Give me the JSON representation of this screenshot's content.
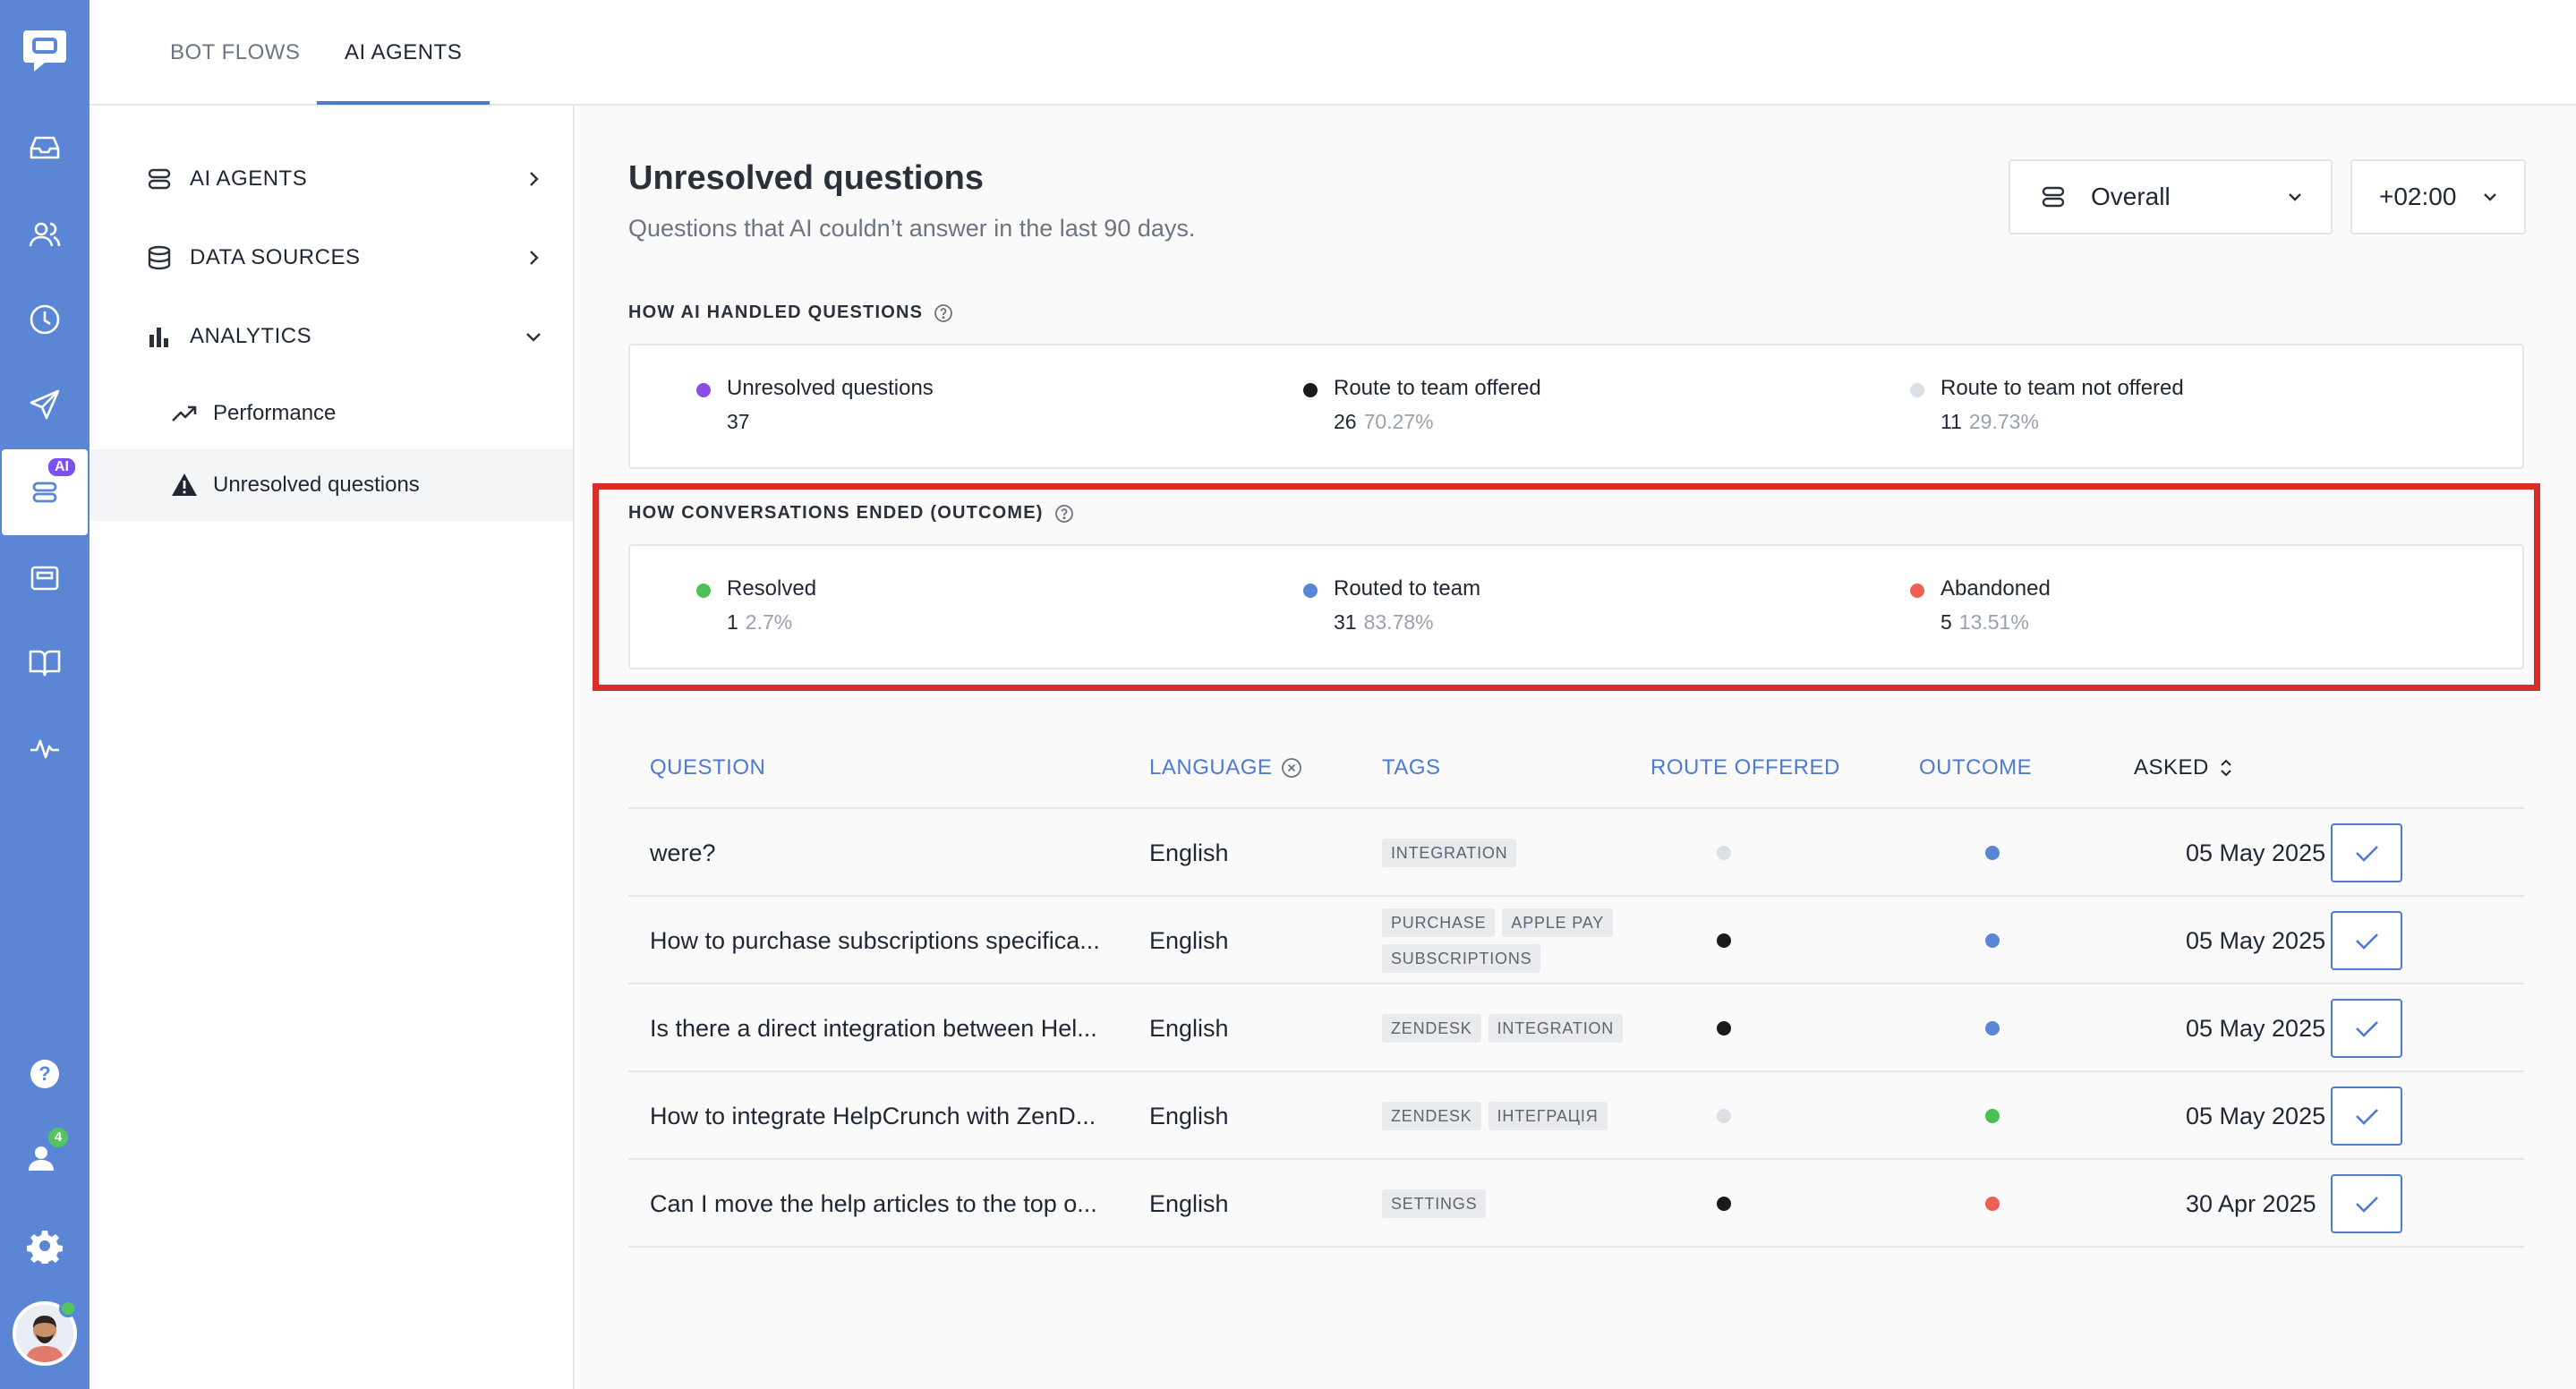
{
  "app": {
    "logo_icon": "chat-bubble-logo-icon"
  },
  "rail": {
    "items": [
      {
        "icon": "inbox-icon"
      },
      {
        "icon": "contacts-icon"
      },
      {
        "icon": "clock-icon"
      },
      {
        "icon": "send-icon"
      },
      {
        "icon": "ai-agent-icon",
        "badge": "AI",
        "active": true
      },
      {
        "icon": "widget-icon"
      },
      {
        "icon": "knowledge-base-icon"
      },
      {
        "icon": "activity-icon"
      }
    ],
    "bottom": [
      {
        "icon": "help-icon"
      },
      {
        "icon": "team-icon",
        "badge": "4"
      },
      {
        "icon": "settings-icon"
      },
      {
        "icon": "avatar"
      }
    ]
  },
  "topbar": {
    "tabs": [
      {
        "label": "BOT FLOWS"
      },
      {
        "label": "AI AGENTS",
        "active": true
      }
    ]
  },
  "subnav": {
    "items": [
      {
        "label": "AI AGENTS",
        "icon": "ai-agent-icon"
      },
      {
        "label": "DATA SOURCES",
        "icon": "database-icon"
      },
      {
        "label": "ANALYTICS",
        "icon": "bar-chart-icon",
        "expanded": true
      }
    ],
    "sub_items": [
      {
        "label": "Performance",
        "icon": "trend-up-icon"
      },
      {
        "label": "Unresolved questions",
        "icon": "warning-icon",
        "active": true
      }
    ]
  },
  "main": {
    "title": "Unresolved questions",
    "subtitle": "Questions that AI couldn’t answer in the last 90 days.",
    "filter": {
      "agent_value": "Overall",
      "timezone_value": "+02:00"
    },
    "handled": {
      "label": "HOW AI HANDLED QUESTIONS",
      "stats": [
        {
          "name": "Unresolved questions",
          "value": "37",
          "pct": "",
          "color": "#8b4fe6"
        },
        {
          "name": "Route to team offered",
          "value": "26",
          "pct": "70.27%",
          "color": "#1a1a1a"
        },
        {
          "name": "Route to team not offered",
          "value": "11",
          "pct": "29.73%",
          "color": "#dcdfe3"
        }
      ]
    },
    "outcome": {
      "label": "HOW CONVERSATIONS ENDED (OUTCOME)",
      "stats": [
        {
          "name": "Resolved",
          "value": "1",
          "pct": "2.7%",
          "color": "#4cbf55"
        },
        {
          "name": "Routed to team",
          "value": "31",
          "pct": "83.78%",
          "color": "#5b86d6"
        },
        {
          "name": "Abandoned",
          "value": "5",
          "pct": "13.51%",
          "color": "#ee5f55"
        }
      ]
    },
    "table": {
      "headers": {
        "question": "QUESTION",
        "language": "LANGUAGE",
        "tags": "TAGS",
        "route_offered": "ROUTE OFFERED",
        "outcome": "OUTCOME",
        "asked": "ASKED"
      },
      "rows": [
        {
          "question": "were?",
          "language": "English",
          "tags": [
            "INTEGRATION"
          ],
          "route_color": "#dcdfe3",
          "outcome_color": "#5b86d6",
          "asked": "05 May 2025"
        },
        {
          "question": "How to purchase subscriptions specifica...",
          "language": "English",
          "tags": [
            "PURCHASE",
            "APPLE PAY",
            "SUBSCRIPTIONS"
          ],
          "route_color": "#1a1a1a",
          "outcome_color": "#5b86d6",
          "asked": "05 May 2025"
        },
        {
          "question": "Is there a direct integration between Hel...",
          "language": "English",
          "tags": [
            "ZENDESK",
            "INTEGRATION"
          ],
          "route_color": "#1a1a1a",
          "outcome_color": "#5b86d6",
          "asked": "05 May 2025"
        },
        {
          "question": "How to integrate HelpCrunch with ZenD...",
          "language": "English",
          "tags": [
            "ZENDESK",
            "ІНТЕГРАЦІЯ"
          ],
          "route_color": "#dcdfe3",
          "outcome_color": "#4cbf55",
          "asked": "05 May 2025"
        },
        {
          "question": "Can I move the help articles to the top o...",
          "language": "English",
          "tags": [
            "SETTINGS"
          ],
          "route_color": "#1a1a1a",
          "outcome_color": "#ee5f55",
          "asked": "30 Apr 2025"
        }
      ]
    }
  }
}
